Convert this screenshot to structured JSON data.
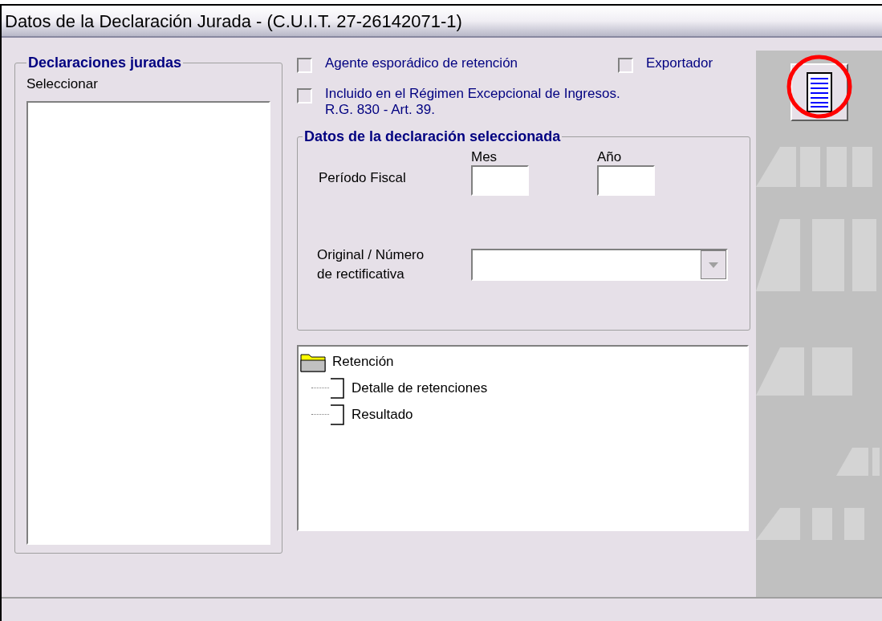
{
  "window": {
    "title": "Datos de la Declaración Jurada - (C.U.I.T. 27-26142071-1)"
  },
  "declaraciones": {
    "title": "Declaraciones juradas",
    "label": "Seleccionar"
  },
  "options": [
    {
      "label": "Agente esporádico de retención",
      "checked": false
    },
    {
      "label": "Exportador",
      "checked": false
    },
    {
      "label": "Incluido en el Régimen Excepcional de Ingresos.\nR.G. 830 - Art. 39.",
      "checked": false
    }
  ],
  "seleccionada": {
    "title": "Datos de la declaración seleccionada",
    "periodo_label": "Período Fiscal",
    "mes_label": "Mes",
    "anio_label": "Año",
    "original_label": "Original / Número\nde rectificativa"
  },
  "tree": [
    {
      "label": "Retención",
      "kind": "folder",
      "children": [
        {
          "label": "Detalle de retenciones",
          "kind": "page"
        },
        {
          "label": "Resultado",
          "kind": "page"
        }
      ]
    }
  ],
  "toolbar": {
    "highlighted": true
  }
}
